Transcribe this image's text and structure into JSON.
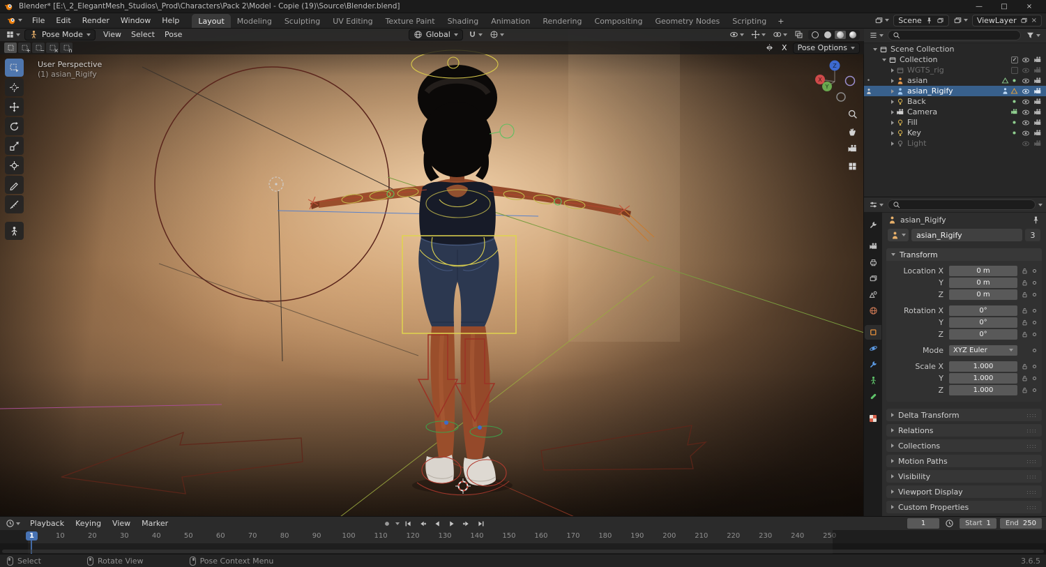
{
  "title_bar": {
    "title": "Blender* [E:\\_2_ElegantMesh_Studios\\_Prod\\Characters\\Pack 2\\Model - Copie (19)\\Source\\Blender.blend]",
    "window_controls": {
      "minimize": "—",
      "maximize": "□",
      "close": "×"
    }
  },
  "topbar": {
    "menus": [
      "File",
      "Edit",
      "Render",
      "Window",
      "Help"
    ],
    "workspaces": [
      "Layout",
      "Modeling",
      "Sculpting",
      "UV Editing",
      "Texture Paint",
      "Shading",
      "Animation",
      "Rendering",
      "Compositing",
      "Geometry Nodes",
      "Scripting"
    ],
    "active_workspace": "Layout",
    "new_workspace_button": "+",
    "scene_selector": {
      "label": "Scene"
    },
    "view_layer_selector": {
      "label": "ViewLayer"
    }
  },
  "viewport": {
    "header": {
      "mode": "Pose Mode",
      "menus": [
        "View",
        "Select",
        "Pose"
      ],
      "orientation": "Global",
      "select_modes": [
        "set",
        "extend",
        "subtract",
        "invert",
        "intersect"
      ],
      "mirror_label": "X",
      "pose_options_label": "Pose Options"
    },
    "tools": [
      {
        "name": "select-box",
        "icon": "select",
        "active": true
      },
      {
        "name": "cursor",
        "icon": "cursor3d"
      },
      {
        "name": "move",
        "icon": "move"
      },
      {
        "name": "rotate",
        "icon": "rotate"
      },
      {
        "name": "scale",
        "icon": "scale"
      },
      {
        "name": "transform",
        "icon": "transform"
      },
      {
        "name": "annotate",
        "icon": "annotate"
      },
      {
        "name": "measure",
        "icon": "measure"
      },
      {
        "name": "pose-breakdowner",
        "icon": "pose"
      }
    ],
    "overlay": {
      "perspective": "User Perspective",
      "active_object": "(1) asian_Rigify"
    },
    "gizmo_axes": {
      "x": "X",
      "y": "Y",
      "z": "Z"
    }
  },
  "outliner": {
    "rows": [
      {
        "label": "Scene Collection",
        "depth": 0,
        "arrow": "down",
        "icon": "box",
        "icon_color": "#d0d0d0"
      },
      {
        "label": "Collection",
        "depth": 1,
        "arrow": "down",
        "icon": "box",
        "icon_color": "#d0d0d0",
        "checkbox": "checked",
        "eye": "on",
        "cam": "on"
      },
      {
        "label": "WGTS_rig",
        "depth": 2,
        "arrow": "right",
        "icon": "box",
        "icon_color": "#6f6f6f",
        "dim": true,
        "checkbox": "empty",
        "eye": "dim",
        "cam": "dim"
      },
      {
        "label": "asian",
        "depth": 2,
        "arrow": "right",
        "icon": "person",
        "icon_color": "#e2984f",
        "gutter": "dot",
        "extras": [
          "tri:#8fce8f",
          "dot:#8fce8f"
        ],
        "eye": "on",
        "cam": "on"
      },
      {
        "label": "asian_Rigify",
        "depth": 2,
        "arrow": "right",
        "icon": "person",
        "icon_color": "#9ec7f0",
        "selected": true,
        "gutter": "person",
        "extras": [
          "person:#bcd9f5",
          "tri:#e8a33d"
        ],
        "eye": "on",
        "cam": "on"
      },
      {
        "label": "Back",
        "depth": 2,
        "arrow": "right",
        "icon": "bulb",
        "icon_color": "#d8b44f",
        "extras": [
          "dot:#8fce8f"
        ],
        "eye": "on",
        "cam": "on"
      },
      {
        "label": "Camera",
        "depth": 2,
        "arrow": "right",
        "icon": "cam",
        "icon_color": "#d0d0d0",
        "extras": [
          "cam:#8fce8f"
        ],
        "eye": "on",
        "cam": "on"
      },
      {
        "label": "Fill",
        "depth": 2,
        "arrow": "right",
        "icon": "bulb",
        "icon_color": "#d8b44f",
        "extras": [
          "dot:#8fce8f"
        ],
        "eye": "on",
        "cam": "on"
      },
      {
        "label": "Key",
        "depth": 2,
        "arrow": "right",
        "icon": "bulb",
        "icon_color": "#d8b44f",
        "extras": [
          "dot:#8fce8f"
        ],
        "eye": "on",
        "cam": "on"
      },
      {
        "label": "Light",
        "depth": 2,
        "arrow": "right",
        "icon": "bulb",
        "icon_color": "#7a7a7a",
        "dim": true,
        "eye": "dim",
        "cam": "dim"
      }
    ]
  },
  "properties": {
    "breadcrumb": "asian_Rigify",
    "name_field": "asian_Rigify",
    "users_count": "3",
    "transform_title": "Transform",
    "transform_rows": [
      {
        "label": "Location X",
        "value": "0 m",
        "lock": true
      },
      {
        "label": "Y",
        "value": "0 m",
        "lock": true
      },
      {
        "label": "Z",
        "value": "0 m",
        "lock": true
      },
      {
        "label": "Rotation X",
        "value": "0°",
        "lock": true,
        "gap": true
      },
      {
        "label": "Y",
        "value": "0°",
        "lock": true
      },
      {
        "label": "Z",
        "value": "0°",
        "lock": true
      },
      {
        "label": "Mode",
        "value": "XYZ Euler",
        "dropdown": true,
        "gap": true
      },
      {
        "label": "Scale X",
        "value": "1.000",
        "lock": true,
        "gap": true
      },
      {
        "label": "Y",
        "value": "1.000",
        "lock": true
      },
      {
        "label": "Z",
        "value": "1.000",
        "lock": true
      }
    ],
    "sections": [
      "Delta Transform",
      "Relations",
      "Collections",
      "Motion Paths",
      "Visibility",
      "Viewport Display",
      "Custom Properties"
    ],
    "tabs": [
      {
        "name": "tool",
        "kind": "tool"
      },
      {
        "name": "render",
        "kind": "render",
        "break_before": true
      },
      {
        "name": "output",
        "kind": "output"
      },
      {
        "name": "view-layer",
        "kind": "viewlayer"
      },
      {
        "name": "scene",
        "kind": "scene"
      },
      {
        "name": "world",
        "kind": "world"
      },
      {
        "name": "object",
        "kind": "object",
        "active": true,
        "break_before": true
      },
      {
        "name": "physics",
        "kind": "physics"
      },
      {
        "name": "constraints",
        "kind": "constraints"
      },
      {
        "name": "object-data",
        "kind": "data"
      },
      {
        "name": "bone",
        "kind": "bone"
      },
      {
        "name": "texture",
        "kind": "texture",
        "break_before": true
      }
    ]
  },
  "timeline": {
    "menus": [
      "Playback",
      "Keying",
      "View",
      "Marker"
    ],
    "transport": [
      "jump-start",
      "prev-keyframe",
      "play-reverse",
      "play",
      "next-keyframe",
      "jump-end"
    ],
    "current_frame": "1",
    "start_label": "Start",
    "start_value": "1",
    "end_label": "End",
    "end_value": "250",
    "tick_frames": [
      10,
      20,
      30,
      40,
      50,
      60,
      70,
      80,
      90,
      100,
      110,
      120,
      130,
      140,
      150,
      160,
      170,
      180,
      190,
      200,
      210,
      220,
      230,
      240,
      250
    ]
  },
  "status_bar": {
    "items": [
      {
        "label": "Select",
        "mouse": "left"
      },
      {
        "label": "Rotate View",
        "mouse": "middle"
      },
      {
        "label": "Pose Context Menu",
        "mouse": "right"
      }
    ],
    "version": "3.6.5"
  }
}
